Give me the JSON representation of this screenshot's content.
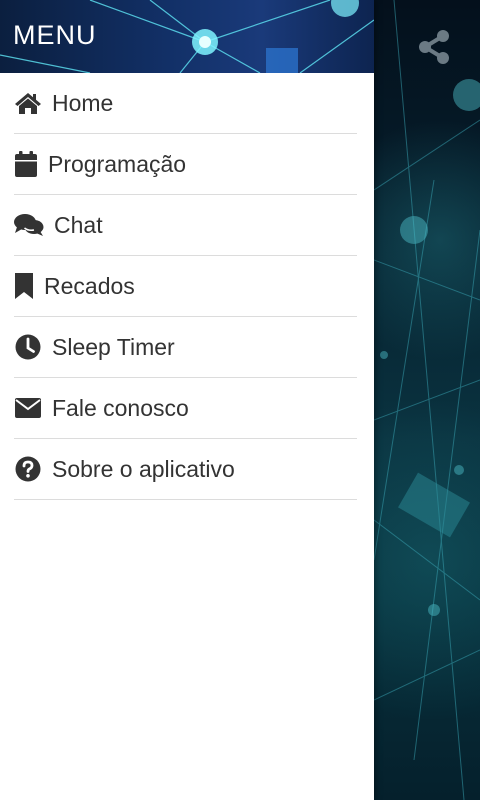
{
  "drawer": {
    "title": "MENU",
    "items": [
      {
        "label": "Home",
        "icon": "home-icon"
      },
      {
        "label": "Programação",
        "icon": "calendar-icon"
      },
      {
        "label": "Chat",
        "icon": "chat-icon"
      },
      {
        "label": "Recados",
        "icon": "bookmark-icon"
      },
      {
        "label": "Sleep Timer",
        "icon": "clock-icon"
      },
      {
        "label": "Fale conosco",
        "icon": "envelope-icon"
      },
      {
        "label": "Sobre o aplicativo",
        "icon": "question-circle-icon"
      }
    ]
  },
  "background": {
    "share_icon": "share-icon"
  },
  "colors": {
    "header_bg": "#123067",
    "accent_network": "#3fd0e0",
    "text": "#333333",
    "divider": "#dcdcdc"
  }
}
